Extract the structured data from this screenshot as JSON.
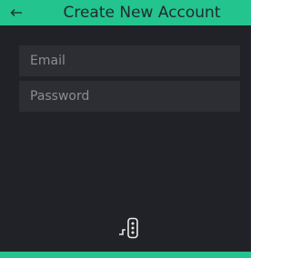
{
  "header": {
    "back_icon": "back-arrow-icon",
    "title": "Create New Account"
  },
  "form": {
    "email_placeholder": "Email",
    "password_placeholder": "Password"
  },
  "footer": {
    "logo_icon": "app-logo-icon"
  },
  "colors": {
    "accent": "#23c48e",
    "background": "#212227",
    "field": "#2d2e33",
    "placeholder": "#8c8d92"
  }
}
